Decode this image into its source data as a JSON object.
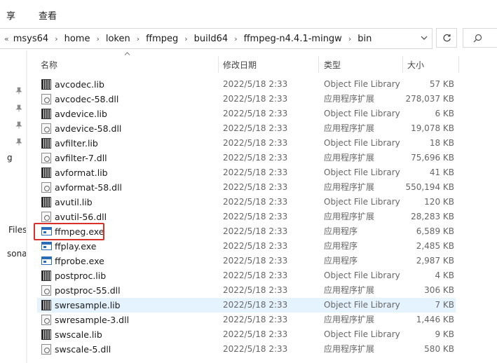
{
  "ribbon": {
    "tabs": [
      "享",
      "查看"
    ]
  },
  "address": {
    "lead": "«",
    "segments": [
      "msys64",
      "home",
      "loken",
      "ffmpeg",
      "build64",
      "ffmpeg-n4.4.1-mingw",
      "bin"
    ],
    "separator": "›"
  },
  "nav": {
    "cut_labels": [
      "g",
      "Files",
      "sona"
    ]
  },
  "columns": {
    "name": "名称",
    "date": "修改日期",
    "type": "类型",
    "size": "大小"
  },
  "files": [
    {
      "name": "avcodec.lib",
      "date": "2022/5/18 2:33",
      "type": "Object File Library",
      "size": "57 KB",
      "icon": "lib"
    },
    {
      "name": "avcodec-58.dll",
      "date": "2022/5/18 2:33",
      "type": "应用程序扩展",
      "size": "278,037 KB",
      "icon": "dll"
    },
    {
      "name": "avdevice.lib",
      "date": "2022/5/18 2:33",
      "type": "Object File Library",
      "size": "6 KB",
      "icon": "lib"
    },
    {
      "name": "avdevice-58.dll",
      "date": "2022/5/18 2:33",
      "type": "应用程序扩展",
      "size": "19,078 KB",
      "icon": "dll"
    },
    {
      "name": "avfilter.lib",
      "date": "2022/5/18 2:33",
      "type": "Object File Library",
      "size": "18 KB",
      "icon": "lib"
    },
    {
      "name": "avfilter-7.dll",
      "date": "2022/5/18 2:33",
      "type": "应用程序扩展",
      "size": "75,696 KB",
      "icon": "dll"
    },
    {
      "name": "avformat.lib",
      "date": "2022/5/18 2:33",
      "type": "Object File Library",
      "size": "41 KB",
      "icon": "lib"
    },
    {
      "name": "avformat-58.dll",
      "date": "2022/5/18 2:33",
      "type": "应用程序扩展",
      "size": "550,194 KB",
      "icon": "dll"
    },
    {
      "name": "avutil.lib",
      "date": "2022/5/18 2:33",
      "type": "Object File Library",
      "size": "120 KB",
      "icon": "lib"
    },
    {
      "name": "avutil-56.dll",
      "date": "2022/5/18 2:33",
      "type": "应用程序扩展",
      "size": "28,283 KB",
      "icon": "dll"
    },
    {
      "name": "ffmpeg.exe",
      "date": "2022/5/18 2:33",
      "type": "应用程序",
      "size": "6,589 KB",
      "icon": "exe"
    },
    {
      "name": "ffplay.exe",
      "date": "2022/5/18 2:33",
      "type": "应用程序",
      "size": "2,485 KB",
      "icon": "exe"
    },
    {
      "name": "ffprobe.exe",
      "date": "2022/5/18 2:33",
      "type": "应用程序",
      "size": "2,987 KB",
      "icon": "exe"
    },
    {
      "name": "postproc.lib",
      "date": "2022/5/18 2:33",
      "type": "Object File Library",
      "size": "4 KB",
      "icon": "lib"
    },
    {
      "name": "postproc-55.dll",
      "date": "2022/5/18 2:33",
      "type": "应用程序扩展",
      "size": "306 KB",
      "icon": "dll"
    },
    {
      "name": "swresample.lib",
      "date": "2022/5/18 2:33",
      "type": "Object File Library",
      "size": "7 KB",
      "icon": "lib"
    },
    {
      "name": "swresample-3.dll",
      "date": "2022/5/18 2:33",
      "type": "应用程序扩展",
      "size": "1,446 KB",
      "icon": "dll"
    },
    {
      "name": "swscale.lib",
      "date": "2022/5/18 2:33",
      "type": "Object File Library",
      "size": "9 KB",
      "icon": "lib"
    },
    {
      "name": "swscale-5.dll",
      "date": "2022/5/18 2:33",
      "type": "应用程序扩展",
      "size": "580 KB",
      "icon": "dll"
    }
  ],
  "selected_file": "swresample.lib",
  "highlighted_file": "ffmpeg.exe",
  "colors": {
    "highlight_border": "#d9302c",
    "selected_row": "#e5f3ff",
    "exe_icon": "#2b6cb8"
  }
}
